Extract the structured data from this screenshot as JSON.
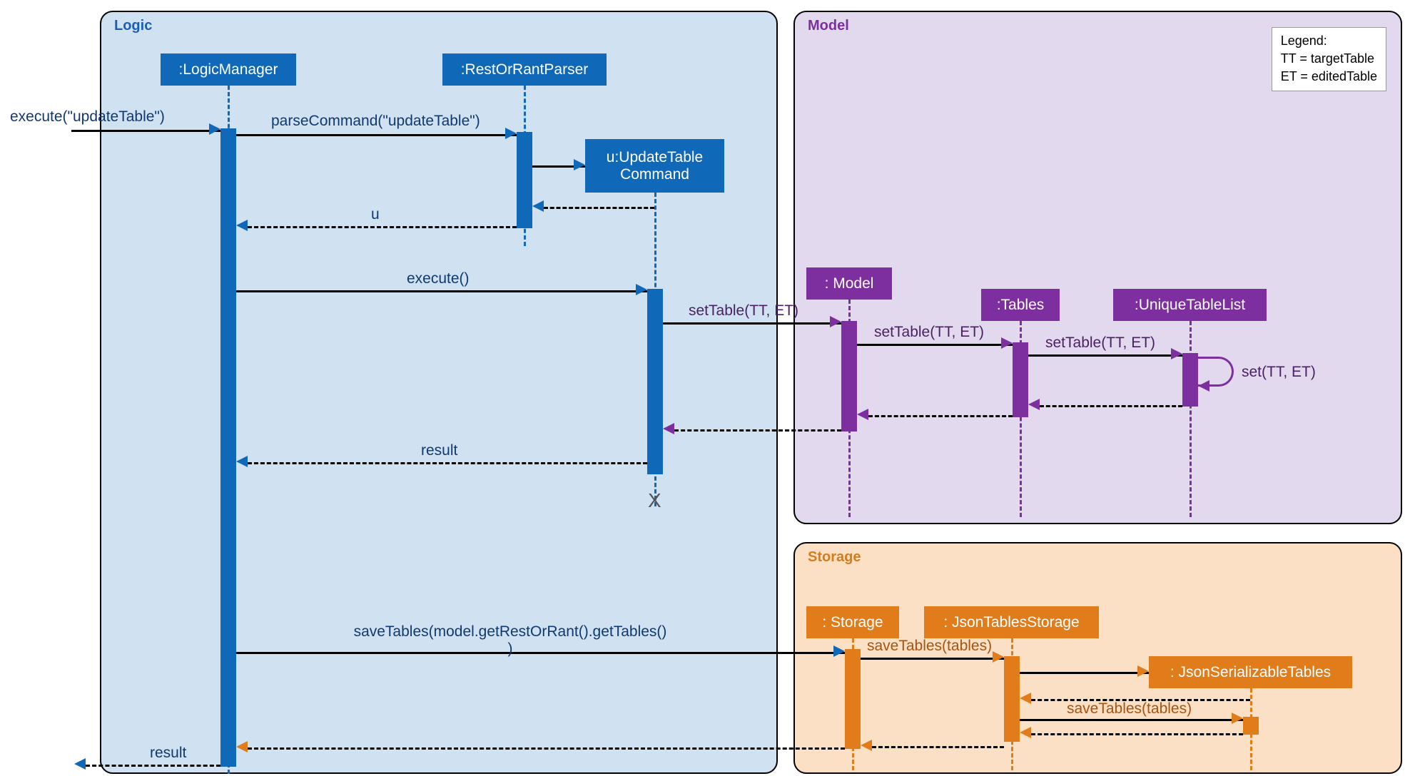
{
  "chart_data": {
    "type": "sequence-diagram",
    "boxes": [
      {
        "name": "Logic",
        "color": "#d0e1f1",
        "participants": [
          "LogicManager",
          "RestOrRantParser",
          "UpdateTableCommand"
        ]
      },
      {
        "name": "Model",
        "color": "#e3d9ee",
        "participants": [
          "Model",
          "Tables",
          "UniqueTableList"
        ]
      },
      {
        "name": "Storage",
        "color": "#fce0c5",
        "participants": [
          "Storage",
          "JsonTablesStorage",
          "JsonSerializableTables"
        ]
      }
    ],
    "participants": {
      "LogicManager": {
        "label": ":LogicManager",
        "box": "Logic"
      },
      "RestOrRantParser": {
        "label": ":RestOrRantParser",
        "box": "Logic"
      },
      "UpdateTableCommand": {
        "label": "u:UpdateTable\nCommand",
        "box": "Logic"
      },
      "Model": {
        "label": ": Model",
        "box": "Model"
      },
      "Tables": {
        "label": ":Tables",
        "box": "Model"
      },
      "UniqueTableList": {
        "label": ":UniqueTableList",
        "box": "Model"
      },
      "Storage": {
        "label": ": Storage",
        "box": "Storage"
      },
      "JsonTablesStorage": {
        "label": ": JsonTablesStorage",
        "box": "Storage"
      },
      "JsonSerializableTables": {
        "label": ": JsonSerializableTables",
        "box": "Storage"
      }
    },
    "legend": {
      "title": "Legend:",
      "lines": [
        "TT = targetTable",
        "ET = editedTable"
      ]
    },
    "messages": [
      {
        "from": "caller",
        "to": "LogicManager",
        "label": "execute(\"updateTable\")",
        "type": "call"
      },
      {
        "from": "LogicManager",
        "to": "RestOrRantParser",
        "label": "parseCommand(\"updateTable\")",
        "type": "call"
      },
      {
        "from": "RestOrRantParser",
        "to": "UpdateTableCommand",
        "label": "",
        "type": "create"
      },
      {
        "from": "UpdateTableCommand",
        "to": "RestOrRantParser",
        "label": "",
        "type": "return"
      },
      {
        "from": "RestOrRantParser",
        "to": "LogicManager",
        "label": "u",
        "type": "return"
      },
      {
        "from": "LogicManager",
        "to": "UpdateTableCommand",
        "label": "execute()",
        "type": "call"
      },
      {
        "from": "UpdateTableCommand",
        "to": "Model",
        "label": "setTable(TT, ET)",
        "type": "call"
      },
      {
        "from": "Model",
        "to": "Tables",
        "label": "setTable(TT, ET)",
        "type": "call"
      },
      {
        "from": "Tables",
        "to": "UniqueTableList",
        "label": "setTable(TT, ET)",
        "type": "call"
      },
      {
        "from": "UniqueTableList",
        "to": "UniqueTableList",
        "label": "set(TT, ET)",
        "type": "self"
      },
      {
        "from": "UniqueTableList",
        "to": "Tables",
        "label": "",
        "type": "return"
      },
      {
        "from": "Tables",
        "to": "Model",
        "label": "",
        "type": "return"
      },
      {
        "from": "Model",
        "to": "UpdateTableCommand",
        "label": "",
        "type": "return"
      },
      {
        "from": "UpdateTableCommand",
        "to": "LogicManager",
        "label": "result",
        "type": "return"
      },
      {
        "from": "UpdateTableCommand",
        "to": null,
        "label": "",
        "type": "destroy",
        "marker": "X"
      },
      {
        "from": "LogicManager",
        "to": "Storage",
        "label": "saveTables(model.getRestOrRant().getTables()\n)",
        "type": "call"
      },
      {
        "from": "Storage",
        "to": "JsonTablesStorage",
        "label": "saveTables(tables)",
        "type": "call"
      },
      {
        "from": "JsonTablesStorage",
        "to": "JsonSerializableTables",
        "label": "",
        "type": "create"
      },
      {
        "from": "JsonSerializableTables",
        "to": "JsonTablesStorage",
        "label": "",
        "type": "return"
      },
      {
        "from": "JsonTablesStorage",
        "to": "JsonSerializableTables",
        "label": "saveTables(tables)",
        "type": "call"
      },
      {
        "from": "JsonSerializableTables",
        "to": "JsonTablesStorage",
        "label": "",
        "type": "return"
      },
      {
        "from": "JsonTablesStorage",
        "to": "Storage",
        "label": "",
        "type": "return"
      },
      {
        "from": "Storage",
        "to": "LogicManager",
        "label": "",
        "type": "return"
      },
      {
        "from": "LogicManager",
        "to": "caller",
        "label": "result",
        "type": "return"
      }
    ]
  },
  "boxes": {
    "logic": "Logic",
    "model": "Model",
    "storage": "Storage"
  },
  "legend": {
    "title": "Legend:",
    "line1": "TT = targetTable",
    "line2": "ET = editedTable"
  },
  "participants": {
    "logicManager": ":LogicManager",
    "restOrRantParser": ":RestOrRantParser",
    "updateTableCmd": "u:UpdateTable\nCommand",
    "model": ": Model",
    "tables": ":Tables",
    "uniqueTableList": ":UniqueTableList",
    "storage": ": Storage",
    "jsonTablesStorage": ": JsonTablesStorage",
    "jsonSerTables": ": JsonSerializableTables"
  },
  "labels": {
    "execCmd": "execute(\"updateTable\")",
    "parseCmd": "parseCommand(\"updateTable\")",
    "u": "u",
    "execute": "execute()",
    "setTable": "setTable(TT, ET)",
    "set": "set(TT, ET)",
    "result": "result",
    "saveTablesLong": "saveTables(model.getRestOrRant().getTables()\n)",
    "saveTables": "saveTables(tables)",
    "x": "X"
  }
}
